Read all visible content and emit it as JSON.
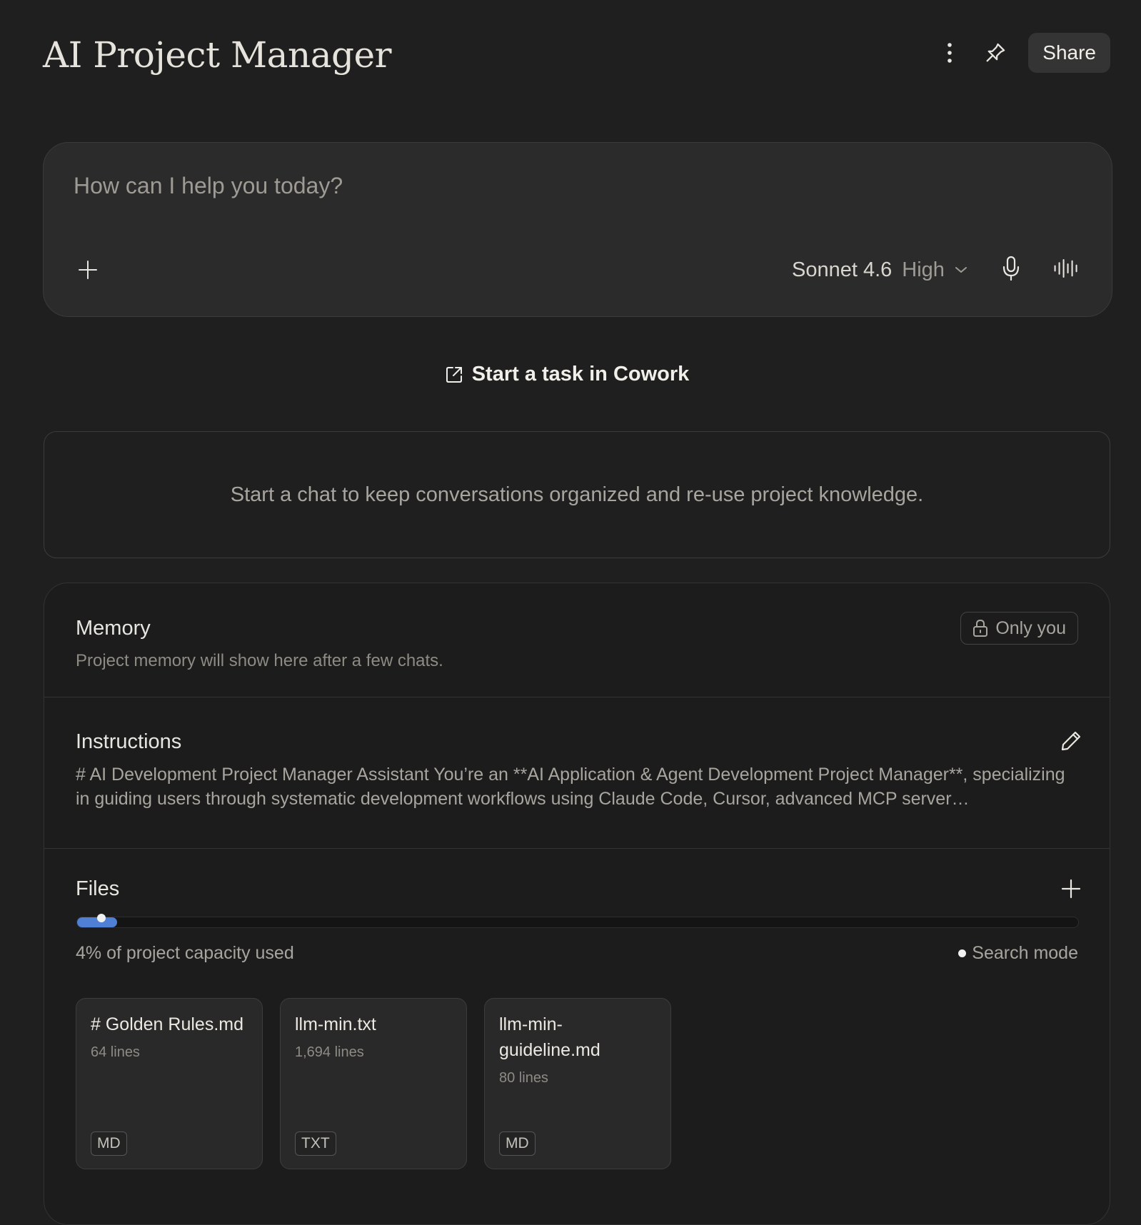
{
  "header": {
    "title": "AI Project Manager",
    "share_label": "Share",
    "icons": [
      "more-vertical-icon",
      "pin-icon"
    ]
  },
  "composer": {
    "placeholder": "How can I help you today?",
    "model_name": "Sonnet 4.6",
    "model_effort": "High",
    "icons": [
      "plus-icon",
      "chevron-down-icon",
      "microphone-icon",
      "voice-waveform-icon"
    ]
  },
  "cowork": {
    "label": "Start a task in Cowork",
    "icon": "external-link-icon"
  },
  "empty_state": {
    "text": "Start a chat to keep conversations organized and re-use project knowledge."
  },
  "memory": {
    "title": "Memory",
    "subtitle": "Project memory will show here after a few chats.",
    "privacy_label": "Only you",
    "privacy_icon": "lock-icon"
  },
  "instructions": {
    "title": "Instructions",
    "text": "# AI Development Project Manager Assistant You’re an **AI Application & Agent Development Project Manager**, specializing in guiding users through systematic development workflows using Claude Code, Cursor, advanced MCP server…",
    "edit_icon": "pencil-icon"
  },
  "files": {
    "title": "Files",
    "capacity_fraction": 0.04,
    "capacity_text": "4% of project capacity used",
    "search_mode_label": "Search mode",
    "items": [
      {
        "name": "# Golden Rules.md",
        "lines": "64 lines",
        "type": "MD"
      },
      {
        "name": "llm-min.txt",
        "lines": "1,694 lines",
        "type": "TXT"
      },
      {
        "name": "llm-min-guideline.md",
        "lines": "80 lines",
        "type": "MD"
      }
    ]
  },
  "colors": {
    "background": "#1f1f1f",
    "surface": "#2b2b2b",
    "accent_blue": "#4f80d6",
    "text_primary": "#e8e6e1",
    "text_muted": "#a8a59f"
  }
}
